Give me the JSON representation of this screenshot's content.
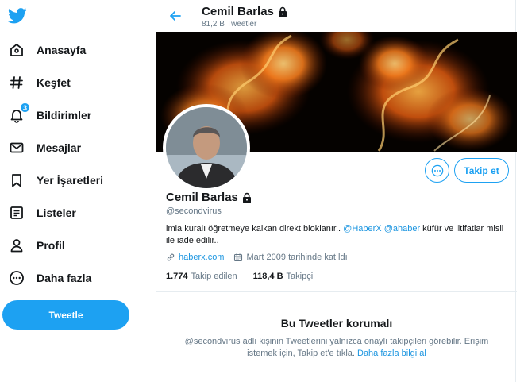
{
  "sidebar": {
    "logo_icon": "twitter-bird-icon",
    "items": [
      {
        "label": "Anasayfa",
        "icon": "home-icon"
      },
      {
        "label": "Keşfet",
        "icon": "hashtag-icon"
      },
      {
        "label": "Bildirimler",
        "icon": "bell-icon",
        "badge": "3"
      },
      {
        "label": "Mesajlar",
        "icon": "envelope-icon"
      },
      {
        "label": "Yer İşaretleri",
        "icon": "bookmark-icon"
      },
      {
        "label": "Listeler",
        "icon": "list-icon"
      },
      {
        "label": "Profil",
        "icon": "person-icon"
      },
      {
        "label": "Daha fazla",
        "icon": "more-circle-icon"
      }
    ],
    "tweet_button": "Tweetle"
  },
  "header": {
    "name": "Cemil Barlas",
    "tweet_count": "81,2 B Tweetler"
  },
  "profile": {
    "name": "Cemil Barlas",
    "handle": "@secondvirus",
    "bio_prefix": "imla kuralı öğretmeye kalkan direkt bloklanır.. ",
    "bio_mention_1": "@HaberX",
    "bio_space": " ",
    "bio_mention_2": "@ahaber",
    "bio_suffix": " küfür ve iltifatlar misli ile iade edilir..",
    "website": "haberx.com",
    "joined": "Mart 2009 tarihinde katıldı",
    "following_count": "1.774",
    "following_label": "Takip edilen",
    "followers_count": "118,4 B",
    "followers_label": "Takipçi",
    "follow_button": "Takip et"
  },
  "protected": {
    "title": "Bu Tweetler korumalı",
    "text": "@secondvirus adlı kişinin Tweetlerini yalnızca onaylı takipçileri görebilir. Erişim istemek için, Takip et'e tıkla. ",
    "learn_more": "Daha fazla bilgi al"
  },
  "colors": {
    "accent": "#1da1f2",
    "link": "#1b95e0",
    "text": "#14171a",
    "muted": "#657786",
    "border": "#e6ecf0"
  }
}
